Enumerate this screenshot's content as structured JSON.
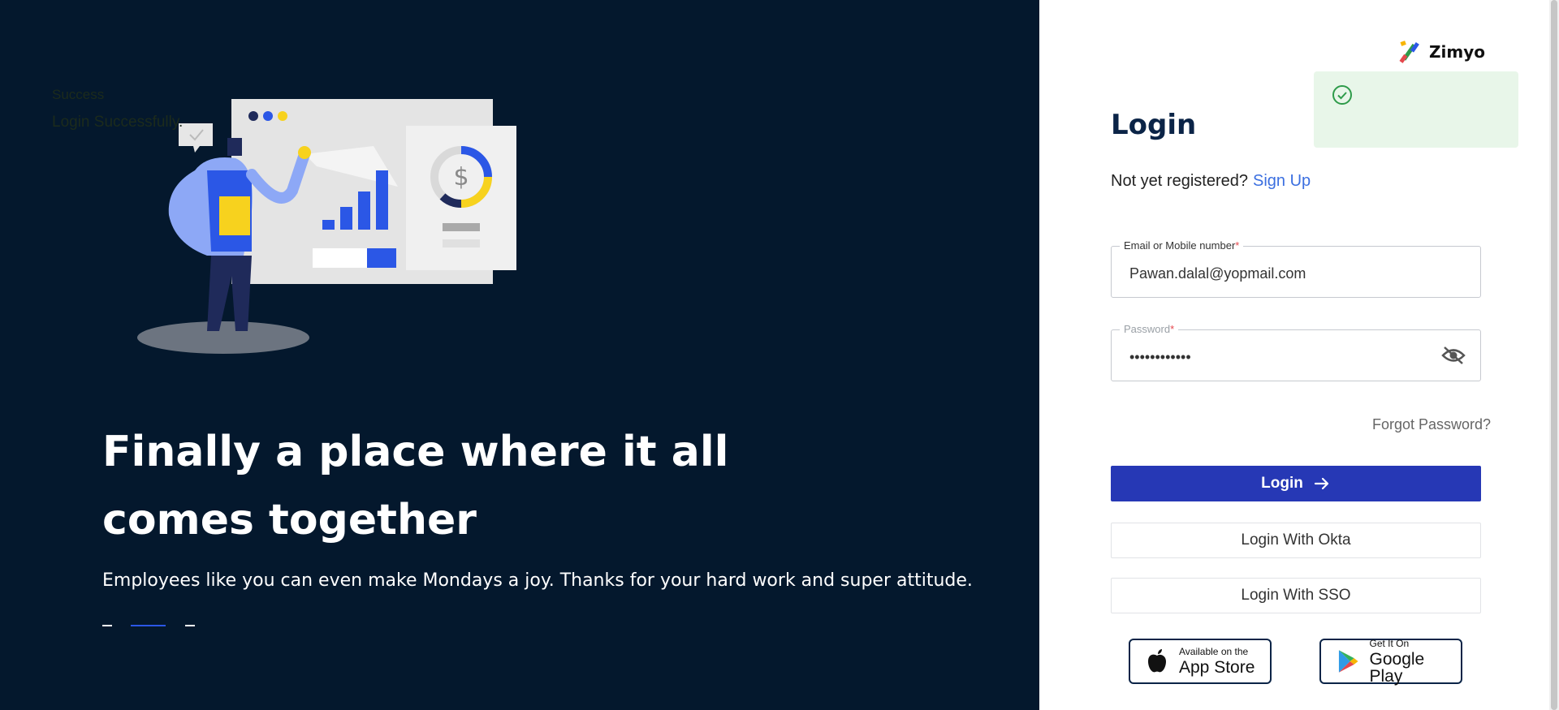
{
  "hero": {
    "headline": "Finally a place where it all comes together",
    "subtext": "Employees like you can even make Mondays a joy. Thanks for your hard work and super attitude.",
    "illustration_icon": "dollar-icon",
    "carousel_active_index": 1,
    "carousel_count": 3
  },
  "brand": {
    "name": "Zimyo"
  },
  "toast": {
    "title": "Success",
    "message": "Login Successfully.",
    "icon": "check-circle-icon"
  },
  "login": {
    "title": "Login",
    "not_registered": "Not yet registered?",
    "signup": "Sign Up",
    "email_label": "Email or Mobile number",
    "email_value": "Pawan.dalal@yopmail.com",
    "password_label": "Password",
    "password_value": "••••••••••••",
    "forgot": "Forgot Password?",
    "login_button": "Login",
    "okta_button": "Login With Okta",
    "sso_button": "Login With SSO"
  },
  "stores": {
    "apple_small": "Available on the",
    "apple_big": "App Store",
    "google_small": "Get It On",
    "google_big": "Google Play"
  },
  "colors": {
    "panel_bg": "#04182d",
    "primary": "#2638b5",
    "link": "#3b6fe0",
    "toast_bg": "#e8f6e9"
  }
}
